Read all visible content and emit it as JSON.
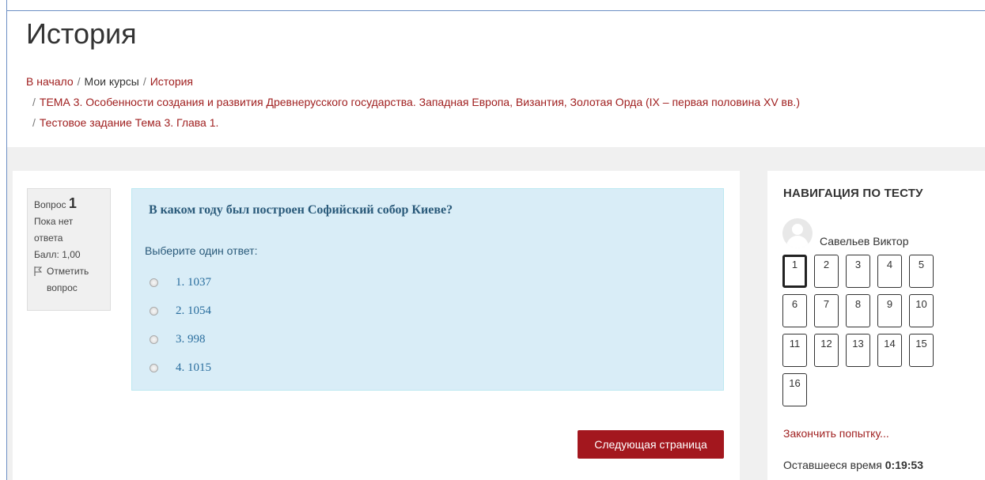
{
  "header": {
    "title": "История",
    "breadcrumb": [
      {
        "label": "В начало",
        "link": true
      },
      {
        "label": "Мои курсы",
        "link": false
      },
      {
        "label": "История",
        "link": true
      },
      {
        "label": "ТЕМА 3. Особенности создания и развития Древнерусского государства. Западная Европа, Византия, Золотая Орда (IX – первая половина XV вв.)",
        "link": true
      },
      {
        "label": "Тестовое задание Тема 3. Глава 1.",
        "link": true
      }
    ],
    "separator": "/"
  },
  "question": {
    "info": {
      "label": "Вопрос",
      "number": "1",
      "status_line1": "Пока нет",
      "status_line2": "ответа",
      "score": "Балл: 1,00",
      "flag_line1": "Отметить",
      "flag_line2": "вопрос"
    },
    "text": "В каком году был построен Софийский собор Киеве?",
    "prompt": "Выберите один ответ:",
    "answers": [
      "1. 1037",
      "2. 1054",
      "3. 998",
      "4. 1015"
    ],
    "next_button": "Следующая страница"
  },
  "navigation": {
    "title": "НАВИГАЦИЯ ПО ТЕСТУ",
    "user_name": "Савельев Виктор",
    "questions": [
      "1",
      "2",
      "3",
      "4",
      "5",
      "6",
      "7",
      "8",
      "9",
      "10",
      "11",
      "12",
      "13",
      "14",
      "15",
      "16"
    ],
    "current": "1",
    "finish_link": "Закончить попытку...",
    "time_label": "Оставшееся время",
    "time_value": "0:19:53"
  },
  "colors": {
    "accent": "#a3171e",
    "link": "#a02020",
    "question_bg": "#d9edf7"
  }
}
